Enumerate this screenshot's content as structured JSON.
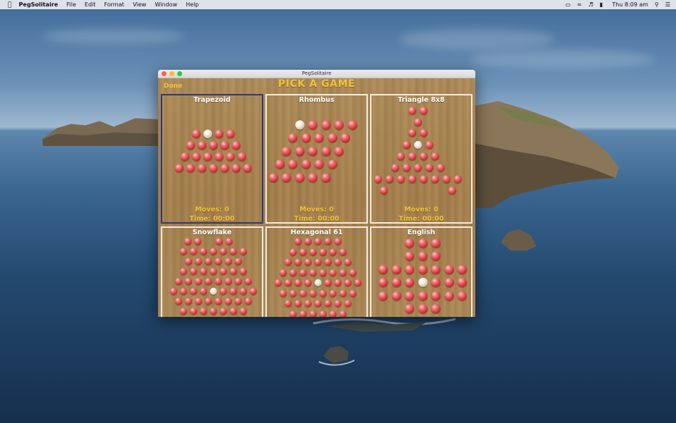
{
  "menubar": {
    "apple": "",
    "app_name": "PegSolitaire",
    "menus": [
      "File",
      "Edit",
      "Format",
      "View",
      "Window",
      "Help"
    ],
    "clock": "Thu 8:09 am",
    "status_icons": [
      "airplay-icon",
      "wifi-icon",
      "volume-icon",
      "battery-icon",
      "search-icon",
      "menu-list-icon"
    ]
  },
  "window": {
    "title": "PegSolitaire",
    "done_label": "Done",
    "heading": "PICK A GAME"
  },
  "games": [
    {
      "name": "Trapezoid",
      "moves": "Moves: 0",
      "time": "Time: 00:00",
      "selected": true
    },
    {
      "name": "Rhombus",
      "moves": "Moves: 0",
      "time": "Time: 00:00",
      "selected": false
    },
    {
      "name": "Triangle 8x8",
      "moves": "Moves: 0",
      "time": "Time: 00:00",
      "selected": false
    },
    {
      "name": "Snowflake",
      "selected": false
    },
    {
      "name": "Hexagonal 61",
      "selected": false
    },
    {
      "name": "English",
      "selected": false
    }
  ],
  "colors": {
    "accent_text": "#f0c23a",
    "peg_red": "#d0303a",
    "peg_empty": "#eee9df",
    "selection_border": "#2a3a82",
    "tile_border": "#f3ece0"
  }
}
